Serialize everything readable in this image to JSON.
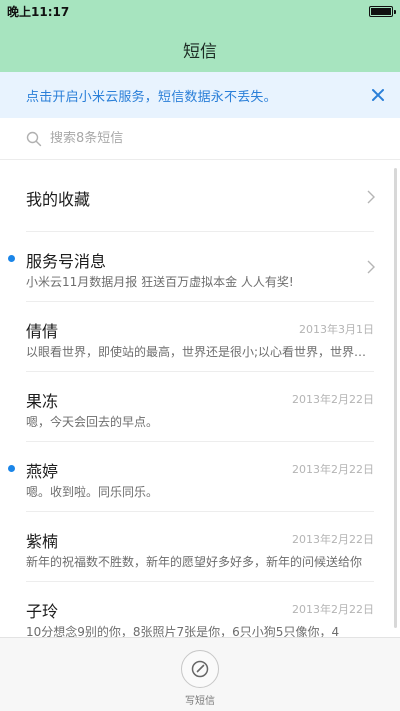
{
  "status_bar": {
    "time": "晚上11:17"
  },
  "header": {
    "title": "短信"
  },
  "cloud_banner": {
    "text": "点击开启小米云服务，短信数据永不丢失。"
  },
  "search": {
    "placeholder": "搜索8条短信"
  },
  "favorites": {
    "label": "我的收藏"
  },
  "threads": [
    {
      "name": "服务号消息",
      "date": "",
      "preview": "小米云11月数据月报 狂送百万虚拟本金 人人有奖!",
      "unread": true
    },
    {
      "name": "倩倩",
      "date": "2013年3月1日",
      "preview": "以眼看世界，即使站的最高，世界还是很小;以心看世界，世界很大很大",
      "unread": false
    },
    {
      "name": "果冻",
      "date": "2013年2月22日",
      "preview": "嗯，今天会回去的早点。",
      "unread": false
    },
    {
      "name": "燕婷",
      "date": "2013年2月22日",
      "preview": "嗯。收到啦。同乐同乐。",
      "unread": true
    },
    {
      "name": "紫楠",
      "date": "2013年2月22日",
      "preview": "新年的祝福数不胜数，新年的愿望好多好多，新年的问候送给你",
      "unread": false
    },
    {
      "name": "子玲",
      "date": "2013年2月22日",
      "preview": "10分想念9别的你，8张照片7张是你，6只小狗5只像你，4",
      "unread": false
    }
  ],
  "bottom_bar": {
    "compose_label": "写短信"
  },
  "colors": {
    "header": "#a7e4bf",
    "accent_blue": "#2a7fd8",
    "unread_dot": "#1a85e8",
    "banner_bg": "#e8f3fe"
  },
  "icons": {
    "search": "search-icon",
    "close": "close-icon",
    "chevron": "chevron-right-icon",
    "compose": "compose-icon"
  }
}
